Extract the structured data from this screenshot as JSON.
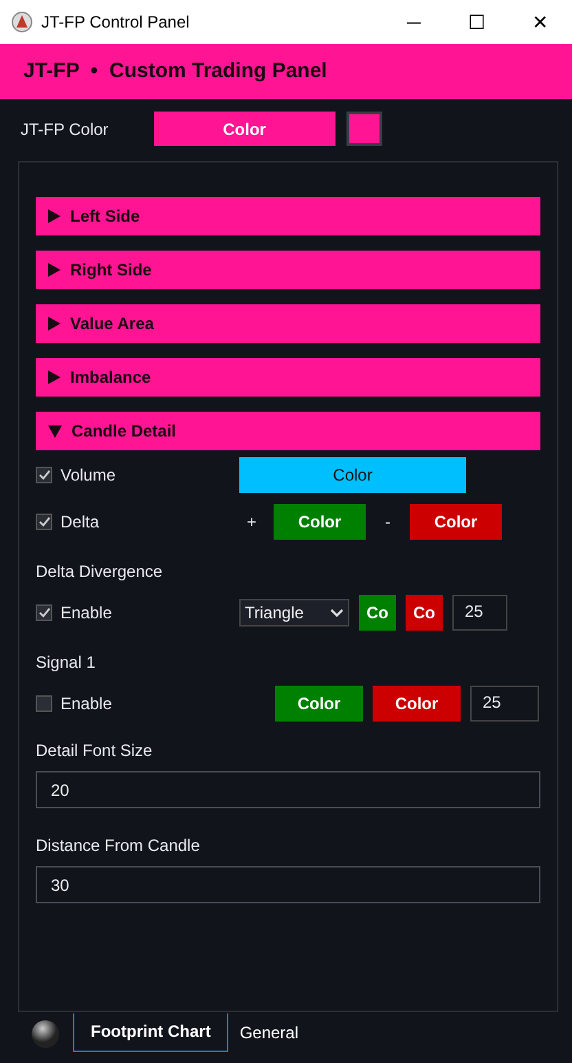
{
  "window": {
    "title": "JT-FP Control Panel",
    "controls": [
      "─",
      "☐",
      "✕"
    ]
  },
  "header": {
    "title": "JT-FP  •  Custom Trading Panel"
  },
  "theme_color": {
    "label": "JT-FP Color",
    "button": "Color",
    "color": "#ff1493"
  },
  "sections": [
    {
      "label": "Left Side",
      "expanded": false
    },
    {
      "label": "Right Side",
      "expanded": false
    },
    {
      "label": "Value Area",
      "expanded": false
    },
    {
      "label": "Imbalance",
      "expanded": false
    },
    {
      "label": "Candle Detail",
      "expanded": true,
      "rows": [
        {
          "kind": "check",
          "label": "Volume",
          "checked": true,
          "controls": [
            {
              "kind": "button",
              "label": "Color",
              "color": "#00bfff"
            }
          ]
        },
        {
          "kind": "check",
          "label": "Delta",
          "checked": true,
          "controls": [
            {
              "kind": "sign",
              "label": "+"
            },
            {
              "kind": "button",
              "label": "Color",
              "color": "#008000"
            },
            {
              "kind": "sign",
              "label": "-"
            },
            {
              "kind": "button",
              "label": "Color",
              "color": "#cc0000"
            }
          ]
        },
        {
          "kind": "heading",
          "label": "Delta Divergence"
        },
        {
          "kind": "check",
          "label": "Enable",
          "checked": true,
          "controls": [
            {
              "kind": "select",
              "label": "Triangle"
            },
            {
              "kind": "button",
              "label": "Co",
              "color": "#008000"
            },
            {
              "kind": "button",
              "label": "Co",
              "color": "#cc0000"
            },
            {
              "kind": "number",
              "label": "25"
            }
          ]
        },
        {
          "kind": "heading",
          "label": "Signal 1"
        },
        {
          "kind": "check",
          "label": "Enable",
          "checked": false,
          "controls": [
            {
              "kind": "button",
              "label": "Color",
              "color": "#008000"
            },
            {
              "kind": "button",
              "label": "Color",
              "color": "#cc0000"
            },
            {
              "kind": "number",
              "label": "25"
            }
          ]
        },
        {
          "kind": "field",
          "label": "Detail Font Size",
          "value": "20"
        },
        {
          "kind": "field",
          "label": "Distance From Candle",
          "value": "30"
        }
      ]
    }
  ],
  "tabs": [
    {
      "label": "Footprint Chart",
      "selected": true
    },
    {
      "label": "General",
      "selected": false
    }
  ]
}
